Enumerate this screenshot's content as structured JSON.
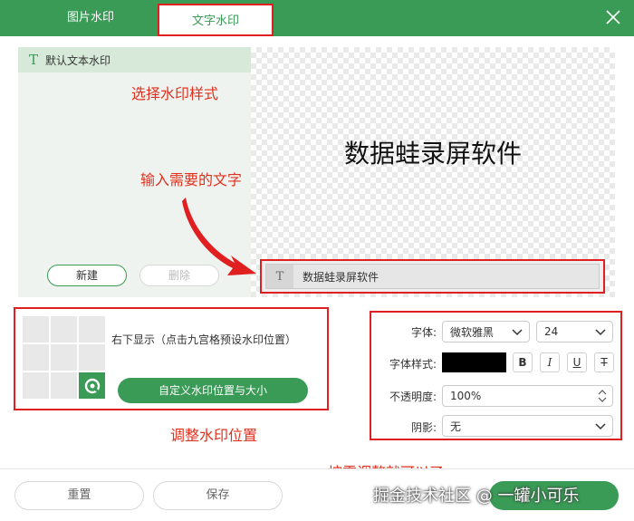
{
  "tabs": [
    {
      "label": "图片水印"
    },
    {
      "label": "文字水印"
    }
  ],
  "icons": {
    "close": "close-icon",
    "text": "text-t-icon",
    "chevron": "chevron-down-icon",
    "logo": "position-logo-icon"
  },
  "colors": {
    "brand": "#3a9b56",
    "annotation": "#e0301e",
    "highlight_border": "#e02020"
  },
  "left_panel": {
    "template_item": "默认文本水印",
    "new_button": "新建",
    "delete_button": "删除"
  },
  "preview": {
    "text": "数据蛙录屏软件"
  },
  "text_input": {
    "value": "数据蛙录屏软件"
  },
  "annotations": {
    "select_style": "选择水印样式",
    "input_text": "输入需要的文字",
    "adjust_position": "调整水印位置",
    "adjust_as_needed": "按需调整就可以了"
  },
  "position": {
    "description": "右下显示（点击九宫格预设水印位置）",
    "custom_button": "自定义水印位置与大小",
    "selected_cell": "bottom-right"
  },
  "style_settings": {
    "font_label": "字体:",
    "font_value": "微软雅黑",
    "size_value": "24",
    "font_style_label": "字体样式:",
    "font_color": "#000000",
    "bold": "B",
    "italic": "I",
    "underline": "U",
    "strike": "T",
    "opacity_label": "不透明度:",
    "opacity_value": "100%",
    "shadow_label": "阴影:",
    "shadow_value": "无"
  },
  "footer": {
    "reset_button": "重置",
    "save_button": "保存",
    "watermark_text": "掘金技术社区 @ 一罐小可乐"
  }
}
